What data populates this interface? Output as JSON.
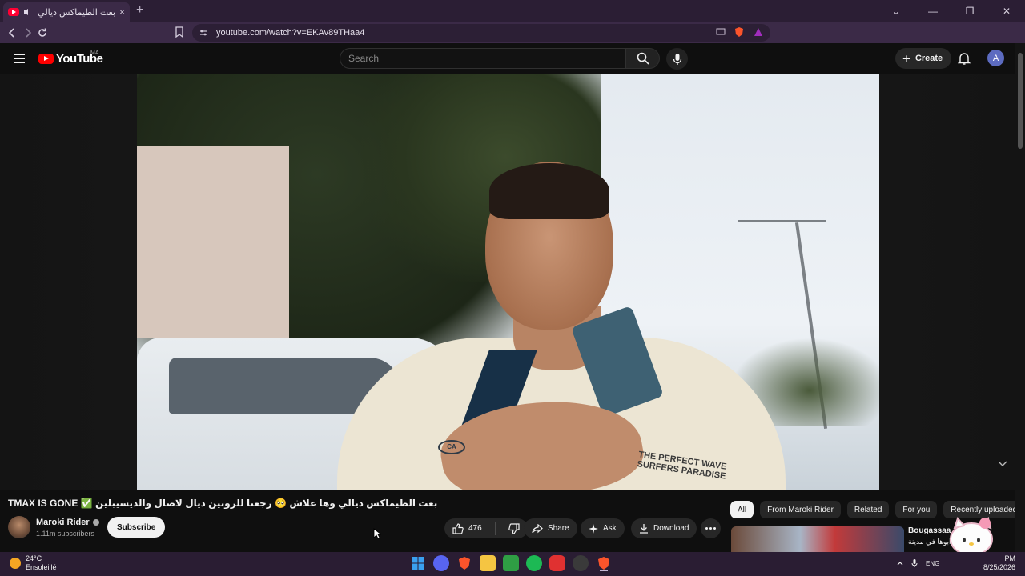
{
  "browser": {
    "tab_title": "بعت الطيماكس ديالي وها علاش",
    "tab_close": "×",
    "new_tab": "+",
    "url": "youtube.com/watch?v=EKAv89THaa4",
    "window_controls": [
      "⌄",
      "—",
      "❐",
      "✕"
    ]
  },
  "masthead": {
    "logo_text": "YouTube",
    "region": "MA",
    "search_placeholder": "Search",
    "create_label": "Create",
    "create_plus": "+",
    "avatar_letter": "A"
  },
  "video": {
    "title": "TMAX IS GONE ✅ بعت الطيماكس ديالي وها علاش 🥺 رجعنا للروتين ديال لاصال والديسيبلين",
    "shirt_print": "THE PERFECT WAVE\nSURFERS PARADISE",
    "shirt_logo": "CA"
  },
  "channel": {
    "name": "Maroki Rider",
    "subscribers": "1.11m subscribers",
    "subscribe_label": "Subscribe"
  },
  "actions": {
    "like_count": "476",
    "share_label": "Share",
    "ask_label": "Ask",
    "download_label": "Download"
  },
  "chips": [
    "All",
    "From Maroki Rider",
    "Related",
    "For you",
    "Recently uploaded"
  ],
  "recommendation": {
    "title": "Bougassaa",
    "subtitle": "غرابوها في مدينة"
  },
  "taskbar": {
    "temperature": "24°C",
    "weather": "Ensoleillé",
    "language": "ENG",
    "time": "PM",
    "date": "8/25/2026"
  },
  "colors": {
    "youtube_red": "#ff0000",
    "page_bg": "#0f0f0f",
    "chrome_bg": "#3b2a47"
  }
}
